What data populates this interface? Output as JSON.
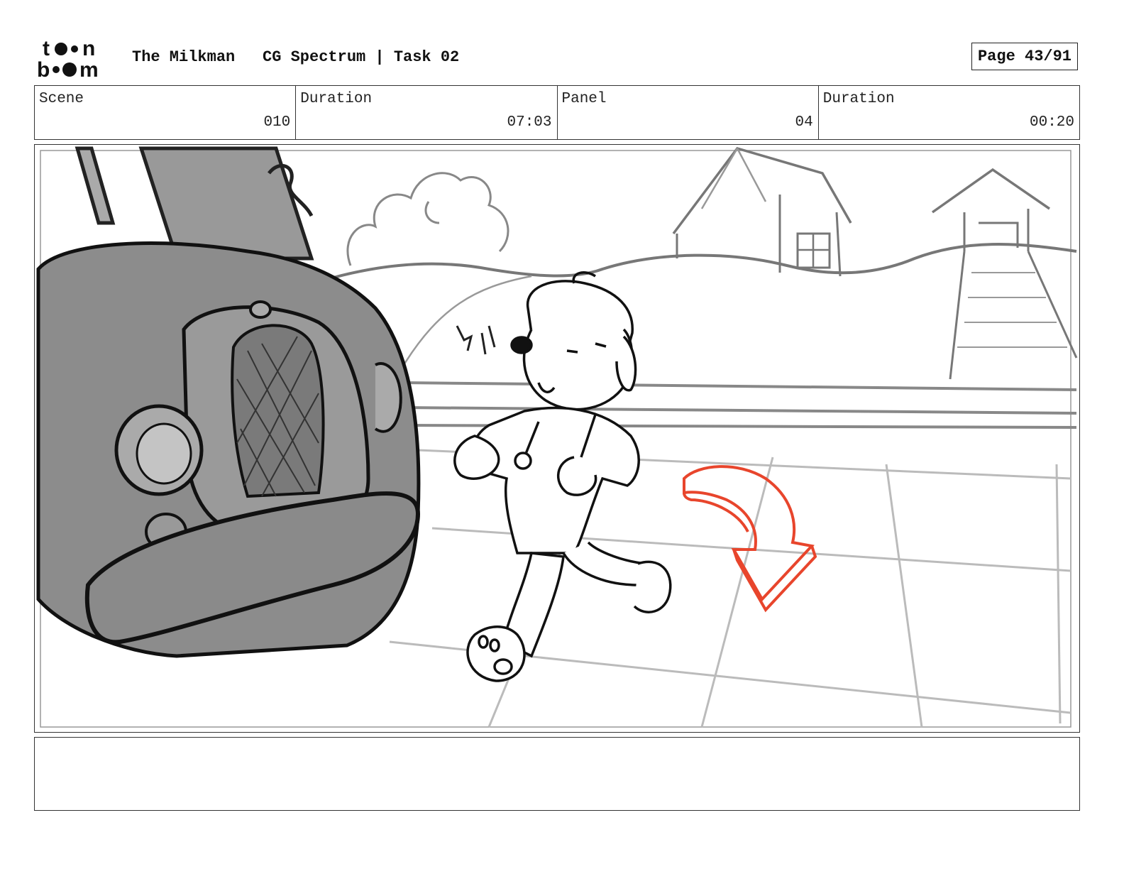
{
  "header": {
    "logo_alt": "toon boom",
    "project": "The Milkman",
    "task": "CG Spectrum | Task 02",
    "page": "Page 43/91"
  },
  "info": [
    {
      "label": "Scene",
      "value": "010"
    },
    {
      "label": "Duration",
      "value": "07:03"
    },
    {
      "label": "Panel",
      "value": "04"
    },
    {
      "label": "Duration",
      "value": "00:20"
    }
  ],
  "panel": {
    "arrow_color": "#e8452c"
  },
  "notes": {
    "text": ""
  }
}
